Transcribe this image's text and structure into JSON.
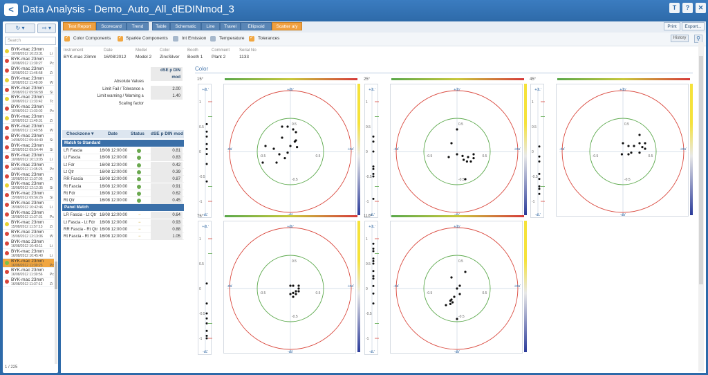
{
  "app": {
    "title": "Data Analysis - Demo_Auto_All_dEDINmod_3",
    "back": "<",
    "buttons": {
      "pin": "T",
      "help": "?",
      "close": "✕"
    }
  },
  "left": {
    "refresh": "↻ ▾",
    "export": "⇨ ▾",
    "search_placeholder": "Search",
    "pager": "1 / 225",
    "items": [
      {
        "name": "BYK-mac 23mm",
        "date": "10/08/2012 10:23:31",
        "tag": "Li",
        "status": "yellow"
      },
      {
        "name": "BYK-mac 23mm",
        "date": "10/08/2012 11:30:27",
        "tag": "Pc",
        "status": "red"
      },
      {
        "name": "BYK-mac 23mm",
        "date": "10/08/2012 11:46:58",
        "tag": "Zi",
        "status": "red"
      },
      {
        "name": "BYK-mac 23mm",
        "date": "10/08/2012 11:48:00",
        "tag": "W",
        "status": "yellow"
      },
      {
        "name": "BYK-mac 23mm",
        "date": "15/08/2012 09:56:58",
        "tag": "Si",
        "status": "red"
      },
      {
        "name": "BYK-mac 23mm",
        "date": "10/08/2012 11:33:42",
        "tag": "Tc",
        "status": "yellow"
      },
      {
        "name": "BYK-mac 23mm",
        "date": "10/08/2012 11:33:02",
        "tag": "Pc",
        "status": "red"
      },
      {
        "name": "BYK-mac 23mm",
        "date": "10/08/2012 11:49:31",
        "tag": "Zi",
        "status": "yellow"
      },
      {
        "name": "BYK-mac 23mm",
        "date": "10/08/2012 11:49:58",
        "tag": "W",
        "status": "red"
      },
      {
        "name": "BYK-mac 23mm",
        "date": "14/08/2012 09:44:40",
        "tag": "Si",
        "status": "red"
      },
      {
        "name": "BYK-mac 23mm",
        "date": "15/08/2012 09:54:44",
        "tag": "Si",
        "status": "red"
      },
      {
        "name": "BYK-mac 23mm",
        "date": "10/08/2012 10:13:05",
        "tag": "Li",
        "status": "red"
      },
      {
        "name": "BYK-mac 23mm",
        "date": "14/08/2012 11:35:26",
        "tag": "Pc",
        "status": "red"
      },
      {
        "name": "BYK-mac 23mm",
        "date": "10/08/2012 11:37:06",
        "tag": "Zi",
        "status": "red"
      },
      {
        "name": "BYK-mac 23mm",
        "date": "15/08/2012 12:12:35",
        "tag": "Si",
        "status": "yellow"
      },
      {
        "name": "BYK-mac 23mm",
        "date": "15/08/2012 09:56:26",
        "tag": "Si",
        "status": "red"
      },
      {
        "name": "BYK-mac 23mm",
        "date": "15/08/2012 10:42:46",
        "tag": "Li",
        "status": "red"
      },
      {
        "name": "BYK-mac 23mm",
        "date": "15/08/2012 11:37:31",
        "tag": "Pc",
        "status": "red"
      },
      {
        "name": "BYK-mac 23mm",
        "date": "15/08/2012 11:57:13",
        "tag": "Zi",
        "status": "yellow"
      },
      {
        "name": "BYK-mac 23mm",
        "date": "15/08/2012 12:13:06",
        "tag": "W",
        "status": "red"
      },
      {
        "name": "BYK-mac 23mm",
        "date": "16/08/2012 10:43:11",
        "tag": "Li",
        "status": "red"
      },
      {
        "name": "BYK-mac 23mm",
        "date": "16/08/2012 10:45:40",
        "tag": "Li",
        "status": "red"
      },
      {
        "name": "BYK-mac 23mm",
        "date": "16/08/2012 11:30:23",
        "tag": "Pc",
        "status": "green",
        "selected": true
      },
      {
        "name": "BYK-mac 23mm",
        "date": "16/08/2012 11:30:56",
        "tag": "Pc",
        "status": "red"
      },
      {
        "name": "BYK-mac 23mm",
        "date": "16/08/2012 11:37:12",
        "tag": "Zi",
        "status": "red"
      }
    ]
  },
  "tabs": [
    "Test Report",
    "Scorecard",
    "Trend",
    "Table",
    "Schematic",
    "Line",
    "Travel",
    "Ellipsoid",
    "Scatter a/y"
  ],
  "actions": {
    "print": "Print",
    "export": "Export..."
  },
  "toggles": [
    {
      "label": "Color Components",
      "on": true
    },
    {
      "label": "Sparkle Components",
      "on": true
    },
    {
      "label": "Int Emission",
      "on": false
    },
    {
      "label": "Temperature",
      "on": false
    },
    {
      "label": "Tolerances",
      "on": true
    }
  ],
  "history": "History",
  "meta": [
    {
      "h": "Instrument",
      "v": "BYK-mac 23mm"
    },
    {
      "h": "Date",
      "v": "16/08/2012"
    },
    {
      "h": "Model",
      "v": "Model 2"
    },
    {
      "h": "Color",
      "v": "ZincSilver"
    },
    {
      "h": "Booth",
      "v": "Booth 1"
    },
    {
      "h": "Comment",
      "v": "Plant 2"
    },
    {
      "h": "Serial No",
      "v": "1133"
    }
  ],
  "panel": {
    "metric_header": "dSE p DIN mod",
    "summary": [
      {
        "label": "Absolute Values",
        "value": ""
      },
      {
        "label": "Limit Fail / Tolerance ±",
        "value": "2.00"
      },
      {
        "label": "Limit warning / Warning ±",
        "value": "1.40"
      },
      {
        "label": "Scaling factor",
        "value": ""
      }
    ],
    "cols": {
      "zone": "Checkzone ▾",
      "date": "Date",
      "status": "Status",
      "metric": "dSE p DIN mod"
    },
    "groups": [
      {
        "title": "Match to Standard",
        "rows": [
          {
            "zone": "LR Fascia",
            "date": "16/08 12:00:00",
            "status": "dot",
            "value": "0.81"
          },
          {
            "zone": "Lt Fascia",
            "date": "16/08 12:00:00",
            "status": "dot",
            "value": "0.83"
          },
          {
            "zone": "Lt Fdr",
            "date": "16/08 12:00:00",
            "status": "dot",
            "value": "0.42"
          },
          {
            "zone": "Lt Qtr",
            "date": "16/08 12:00:00",
            "status": "dot",
            "value": "0.39"
          },
          {
            "zone": "RR Fascia",
            "date": "16/08 12:00:00",
            "status": "dot",
            "value": "0.87"
          },
          {
            "zone": "Rt Fascia",
            "date": "16/08 12:00:00",
            "status": "dot",
            "value": "0.91"
          },
          {
            "zone": "Rt Fdr",
            "date": "16/08 12:00:00",
            "status": "dot",
            "value": "0.62"
          },
          {
            "zone": "Rt Qtr",
            "date": "16/08 12:00:00",
            "status": "dot",
            "value": "0.45"
          }
        ]
      },
      {
        "title": "Panel Match",
        "rows": [
          {
            "zone": "LR Fascia - Lt Qtr",
            "date": "16/08 12:00:00",
            "status": "dash",
            "value": "0.64"
          },
          {
            "zone": "Lt Fascia - Lt Fdr",
            "date": "16/08 12:00:00",
            "status": "dash",
            "value": "0.93"
          },
          {
            "zone": "RR Fascia - Rt Qtr",
            "date": "16/08 12:00:00",
            "status": "dash",
            "value": "0.88"
          },
          {
            "zone": "Rt Fascia - Rt Fdr",
            "date": "16/08 12:00:00",
            "status": "dash",
            "value": "1.05"
          }
        ]
      }
    ]
  },
  "color_section": "Color",
  "chart_data": {
    "type": "scatter",
    "axis_labels": {
      "x_pos": "+da'",
      "x_neg": "-da'",
      "y_pos": "+db'",
      "y_neg": "-db'",
      "l_pos": "+dL'",
      "l_neg": "-dL'"
    },
    "ticks": {
      "l": [
        "1",
        "0.5",
        "0",
        "-0.5",
        "-1"
      ],
      "ab_pos": "0.5",
      "ab_neg": "-0.5"
    },
    "xlim": [
      -1.1,
      1.1
    ],
    "ylim": [
      -1.1,
      1.1
    ],
    "plots": [
      {
        "angle": "15°",
        "L": [
          0.55,
          0.4,
          0.3,
          0.15,
          0.05,
          -0.05,
          -0.25,
          -0.6
        ],
        "points": [
          [
            -0.15,
            0.45
          ],
          [
            -0.05,
            0.45
          ],
          [
            0.05,
            0.4
          ],
          [
            0.1,
            0.35
          ],
          [
            0.08,
            0.18
          ],
          [
            0.0,
            0.1
          ],
          [
            0.12,
            0.08
          ],
          [
            -0.45,
            0.1
          ],
          [
            -0.3,
            0.05
          ],
          [
            -0.2,
            -0.05
          ],
          [
            -0.05,
            -0.02
          ],
          [
            -0.1,
            -0.12
          ],
          [
            -0.25,
            -0.2
          ],
          [
            -0.5,
            -0.2
          ],
          [
            -0.15,
            0.25
          ],
          [
            0.1,
            0.2
          ]
        ]
      },
      {
        "angle": "25°",
        "L": [
          0.3,
          0.2,
          0.0,
          -0.3,
          -0.35,
          -0.45,
          -0.5,
          -0.95
        ],
        "points": [
          [
            0.0,
            0.4
          ],
          [
            -0.1,
            0.15
          ],
          [
            -0.15,
            -0.1
          ],
          [
            0.0,
            -0.05
          ],
          [
            0.1,
            -0.08
          ],
          [
            0.12,
            -0.15
          ],
          [
            0.18,
            -0.18
          ],
          [
            0.3,
            -0.05
          ],
          [
            0.25,
            -0.18
          ],
          [
            0.3,
            -0.12
          ],
          [
            0.2,
            -0.1
          ],
          [
            0.15,
            -0.5
          ]
        ]
      },
      {
        "angle": "45°",
        "L": [
          0.1,
          -0.1,
          -0.2,
          -0.45,
          -0.55,
          -0.7,
          -0.75,
          -0.85
        ],
        "points": [
          [
            0.3,
            0.3
          ],
          [
            0.3,
            0.15
          ],
          [
            0.35,
            0.08
          ],
          [
            0.4,
            0.05
          ],
          [
            0.3,
            -0.02
          ],
          [
            0.2,
            0.1
          ],
          [
            0.1,
            0.1
          ],
          [
            0.0,
            0.15
          ],
          [
            0.1,
            -0.05
          ],
          [
            0.15,
            -0.02
          ],
          [
            0.4,
            0.15
          ],
          [
            -0.02,
            -0.05
          ]
        ]
      },
      {
        "angle": "75°",
        "L": [
          0.1,
          -0.3,
          -0.5,
          -0.6,
          -0.7,
          -0.85,
          -0.95,
          -1.0
        ],
        "points": [
          [
            0.0,
            0.05
          ],
          [
            0.05,
            0.05
          ],
          [
            0.15,
            0.05
          ],
          [
            0.15,
            0.0
          ],
          [
            0.1,
            -0.05
          ],
          [
            0.15,
            -0.05
          ],
          [
            0.05,
            -0.08
          ],
          [
            0.0,
            -0.1
          ],
          [
            0.05,
            -0.15
          ],
          [
            0.1,
            -0.1
          ]
        ]
      },
      {
        "angle": "110°",
        "L": [
          0.9,
          0.8,
          0.75,
          0.6,
          0.55,
          0.5,
          0.35,
          0.25,
          0.2,
          0.05,
          -0.1,
          -0.3
        ],
        "points": [
          [
            0.15,
            0.3
          ],
          [
            -0.1,
            0.2
          ],
          [
            0.05,
            0.05
          ],
          [
            0.0,
            0.0
          ],
          [
            0.05,
            -0.1
          ],
          [
            -0.05,
            -0.15
          ],
          [
            -0.1,
            -0.2
          ],
          [
            -0.12,
            -0.22
          ],
          [
            -0.08,
            -0.25
          ],
          [
            -0.12,
            -0.28
          ],
          [
            -0.2,
            -0.3
          ],
          [
            0.0,
            -0.55
          ]
        ]
      }
    ]
  }
}
